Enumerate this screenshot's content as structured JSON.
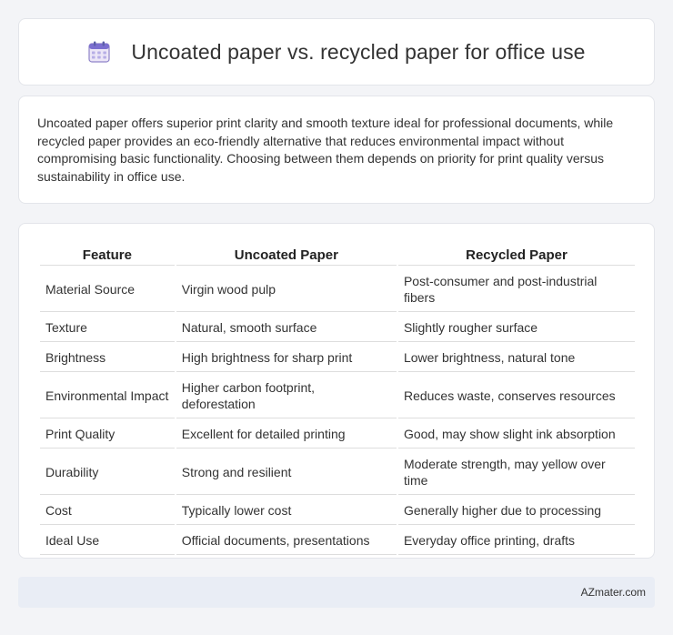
{
  "header": {
    "title": "Uncoated paper vs. recycled paper for office use",
    "icon": "calendar-icon"
  },
  "intro": {
    "text": "Uncoated paper offers superior print clarity and smooth texture ideal for professional documents, while recycled paper provides an eco-friendly alternative that reduces environmental impact without compromising basic functionality. Choosing between them depends on priority for print quality versus sustainability in office use."
  },
  "table": {
    "headers": [
      "Feature",
      "Uncoated Paper",
      "Recycled Paper"
    ],
    "rows": [
      [
        "Material Source",
        "Virgin wood pulp",
        "Post-consumer and post-industrial fibers"
      ],
      [
        "Texture",
        "Natural, smooth surface",
        "Slightly rougher surface"
      ],
      [
        "Brightness",
        "High brightness for sharp print",
        "Lower brightness, natural tone"
      ],
      [
        "Environmental Impact",
        "Higher carbon footprint, deforestation",
        "Reduces waste, conserves resources"
      ],
      [
        "Print Quality",
        "Excellent for detailed printing",
        "Good, may show slight ink absorption"
      ],
      [
        "Durability",
        "Strong and resilient",
        "Moderate strength, may yellow over time"
      ],
      [
        "Cost",
        "Typically lower cost",
        "Generally higher due to processing"
      ],
      [
        "Ideal Use",
        "Official documents, presentations",
        "Everyday office printing, drafts"
      ]
    ]
  },
  "footer": {
    "text": "AZmater.com"
  }
}
